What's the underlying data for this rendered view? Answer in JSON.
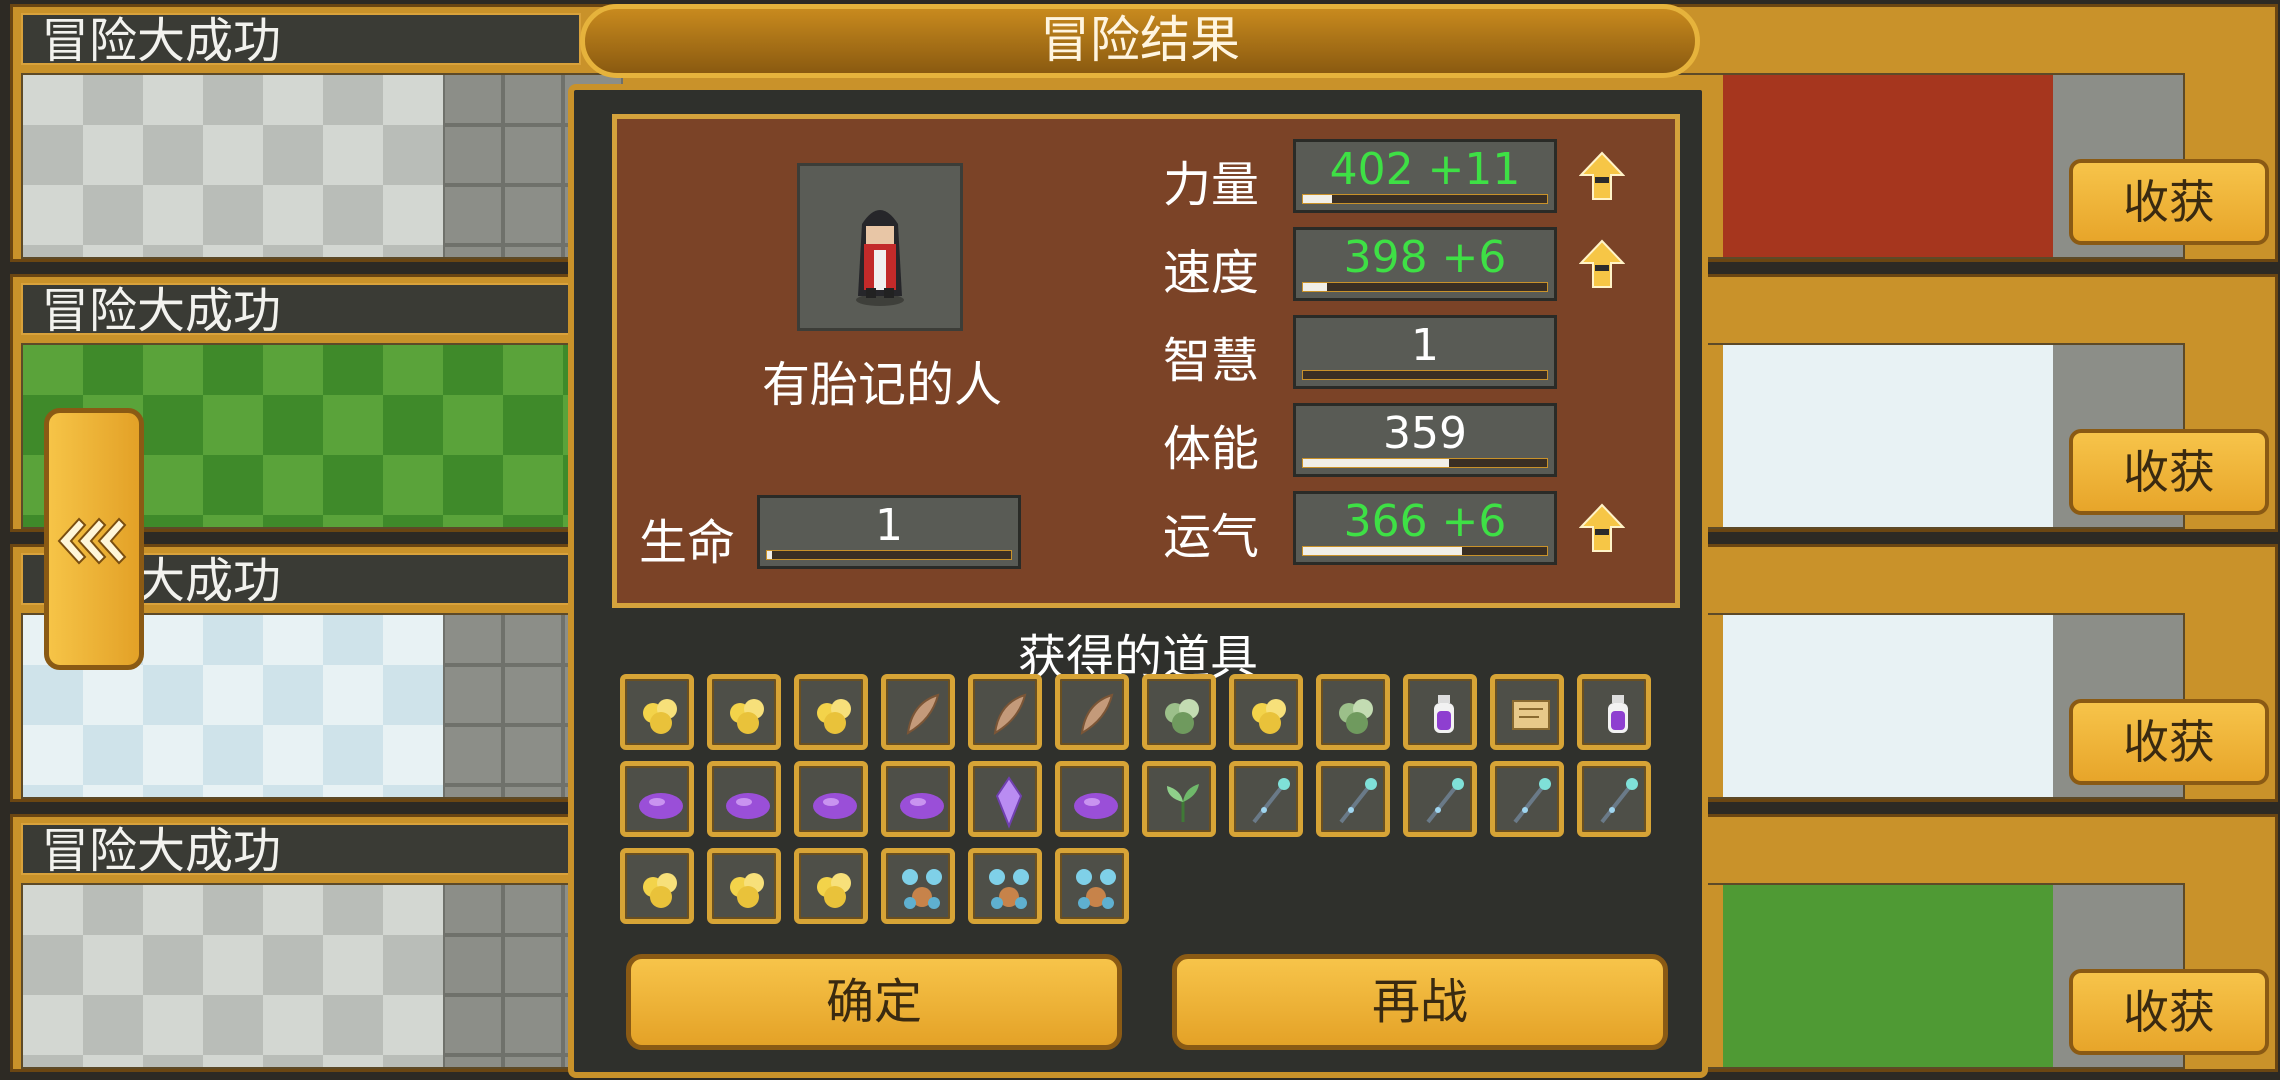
{
  "rows": [
    {
      "title": "冒险大成功",
      "harvest_label": "收获",
      "scene": "dungeon"
    },
    {
      "title": "冒险大成功",
      "harvest_label": "收获",
      "scene": "grass"
    },
    {
      "title": "冒险大成功",
      "harvest_label": "收获",
      "scene": "snow"
    },
    {
      "title": "冒险大成功",
      "harvest_label": "收获",
      "scene": "dungeon"
    }
  ],
  "dialog": {
    "title": "冒险结果",
    "character_name": "有胎记的人",
    "life": {
      "label": "生命",
      "value": "1",
      "fraction": 0.02
    },
    "stats": [
      {
        "label": "力量",
        "value": "402 +11",
        "improved": true,
        "fraction": 0.12
      },
      {
        "label": "速度",
        "value": "398  +6",
        "improved": true,
        "fraction": 0.1
      },
      {
        "label": "智慧",
        "value": "1",
        "improved": false,
        "fraction": 0.0
      },
      {
        "label": "体能",
        "value": "359",
        "improved": false,
        "fraction": 0.6
      },
      {
        "label": "运气",
        "value": "366  +6",
        "improved": true,
        "fraction": 0.65
      }
    ],
    "items_title": "获得的道具",
    "items": [
      "gold-ore",
      "gold-ore",
      "gold-ore",
      "feather",
      "feather",
      "feather",
      "green-ore",
      "gold-ore",
      "green-ore",
      "purple-potion",
      "scroll",
      "purple-potion",
      "purple-slime",
      "purple-slime",
      "purple-slime",
      "purple-slime",
      "purple-crystal",
      "purple-slime",
      "herb",
      "staff",
      "staff",
      "staff",
      "staff",
      "staff",
      "gold-ore",
      "gold-ore",
      "gold-ore",
      "blue-crystal-cluster",
      "blue-crystal-cluster",
      "blue-crystal-cluster"
    ],
    "confirm_label": "确定",
    "retry_label": "再战"
  },
  "colors": {
    "accent": "#e6b33c",
    "stat_up": "#3ee045",
    "panel": "#7b4327"
  }
}
